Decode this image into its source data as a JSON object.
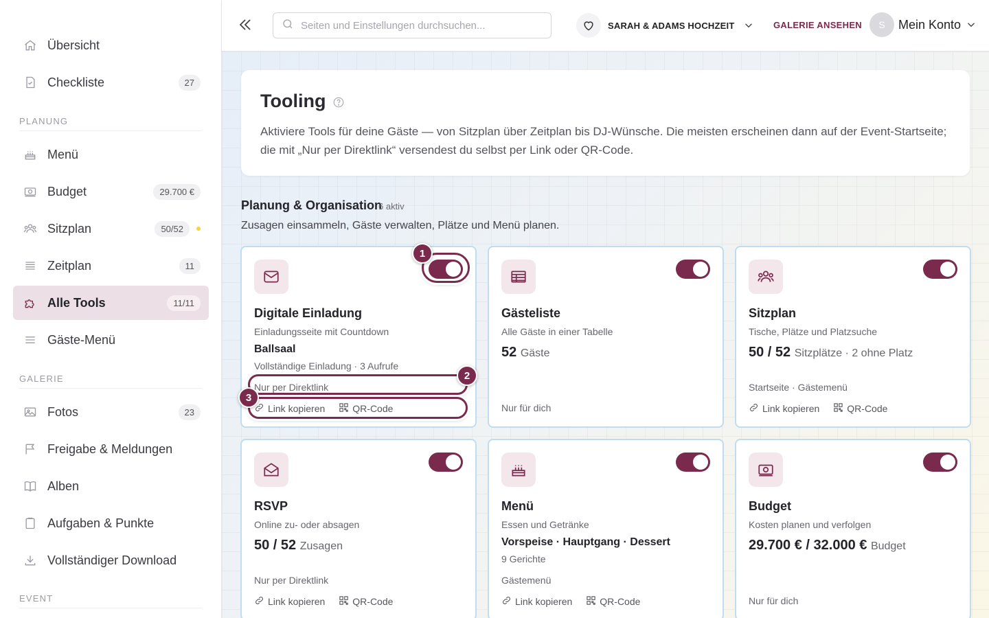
{
  "sidebar": {
    "items": [
      {
        "label": "Übersicht"
      },
      {
        "label": "Checkliste",
        "badge": "27"
      },
      {
        "label": "Menü"
      },
      {
        "label": "Budget",
        "badge": "29.700 €"
      },
      {
        "label": "Sitzplan",
        "badge": "50/52"
      },
      {
        "label": "Zeitplan",
        "badge": "11"
      },
      {
        "label": "Alle Tools",
        "badge": "11/11"
      },
      {
        "label": "Gäste-Menü"
      },
      {
        "label": "Fotos",
        "badge": "23"
      },
      {
        "label": "Freigabe & Meldungen"
      },
      {
        "label": "Alben"
      },
      {
        "label": "Aufgaben & Punkte"
      },
      {
        "label": "Vollständiger Download"
      }
    ],
    "sections": [
      "PLANUNG",
      "GALERIE",
      "EVENT"
    ]
  },
  "header": {
    "search_placeholder": "Seiten und Einstellungen durchsuchen...",
    "event_name": "SARAH & ADAMS HOCHZEIT",
    "gallery_link": "GALERIE ANSEHEN",
    "avatar_initial": "S",
    "account_label": "Mein Konto"
  },
  "hero": {
    "title": "Tooling",
    "text": "Aktiviere Tools für deine Gäste — von Sitzplan über Zeitplan bis DJ-Wünsche. Die meisten erscheinen dann auf der Event-Startseite; die mit „Nur per Direktlink“ versendest du selbst per Link oder QR-Code."
  },
  "group": {
    "title": "Planung & Organisation",
    "count": "6 aktiv",
    "subtitle": "Zusagen einsammeln, Gäste verwalten, Plätze und Menü planen."
  },
  "actions": {
    "copy_link": "Link kopieren",
    "qr": "QR-Code"
  },
  "cards": [
    {
      "title": "Digitale Einladung",
      "desc": "Einladungsseite mit Countdown",
      "sub1": "Ballsaal",
      "sub2": "Vollständige Einladung · 3 Aufrufe",
      "note": "Nur per Direktlink"
    },
    {
      "title": "Gästeliste",
      "desc": "Alle Gäste in einer Tabelle",
      "big": "52",
      "unit": "Gäste",
      "note": "Nur für dich"
    },
    {
      "title": "Sitzplan",
      "desc": "Tische, Plätze und Platzsuche",
      "big": "50 / 52",
      "unit": "Sitzplätze · 2 ohne Platz",
      "note": "Startseite · Gästemenü"
    },
    {
      "title": "RSVP",
      "desc": "Online zu- oder absagen",
      "big": "50 / 52",
      "unit": "Zusagen",
      "note": "Nur per Direktlink"
    },
    {
      "title": "Menü",
      "desc": "Essen und Getränke",
      "sub1": "Vorspeise · Hauptgang · Dessert",
      "sub2": "9 Gerichte",
      "note": "Gästemenü"
    },
    {
      "title": "Budget",
      "desc": "Kosten planen und verfolgen",
      "big": "29.700 € / 32.000 €",
      "unit": "Budget",
      "note": "Nur für dich"
    }
  ],
  "callouts": [
    "1",
    "2",
    "3"
  ],
  "colors": {
    "accent": "#7a2a4c",
    "card_border": "#bfdcf0",
    "status_dot": "#f5d43c"
  }
}
